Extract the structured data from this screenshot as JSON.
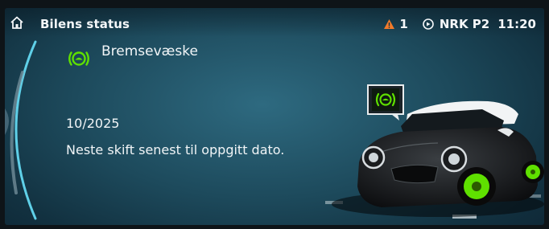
{
  "header": {
    "title": "Bilens status",
    "warning_count": "1",
    "radio_station": "NRK P2",
    "time": "11:20"
  },
  "icons": {
    "home": "home-icon",
    "warning": "warning-triangle-icon",
    "radio": "radio-icon",
    "service_item": "brake-fluid-icon",
    "car_callout": "brake-fluid-callout-icon"
  },
  "service_item": {
    "name": "Bremsevæske",
    "due": "10/2025",
    "note": "Neste skift senest til oppgitt dato."
  },
  "colors": {
    "accent_green": "#5fe000",
    "warning_orange": "#f07a2a",
    "arc_cyan": "#5fd0e8"
  }
}
